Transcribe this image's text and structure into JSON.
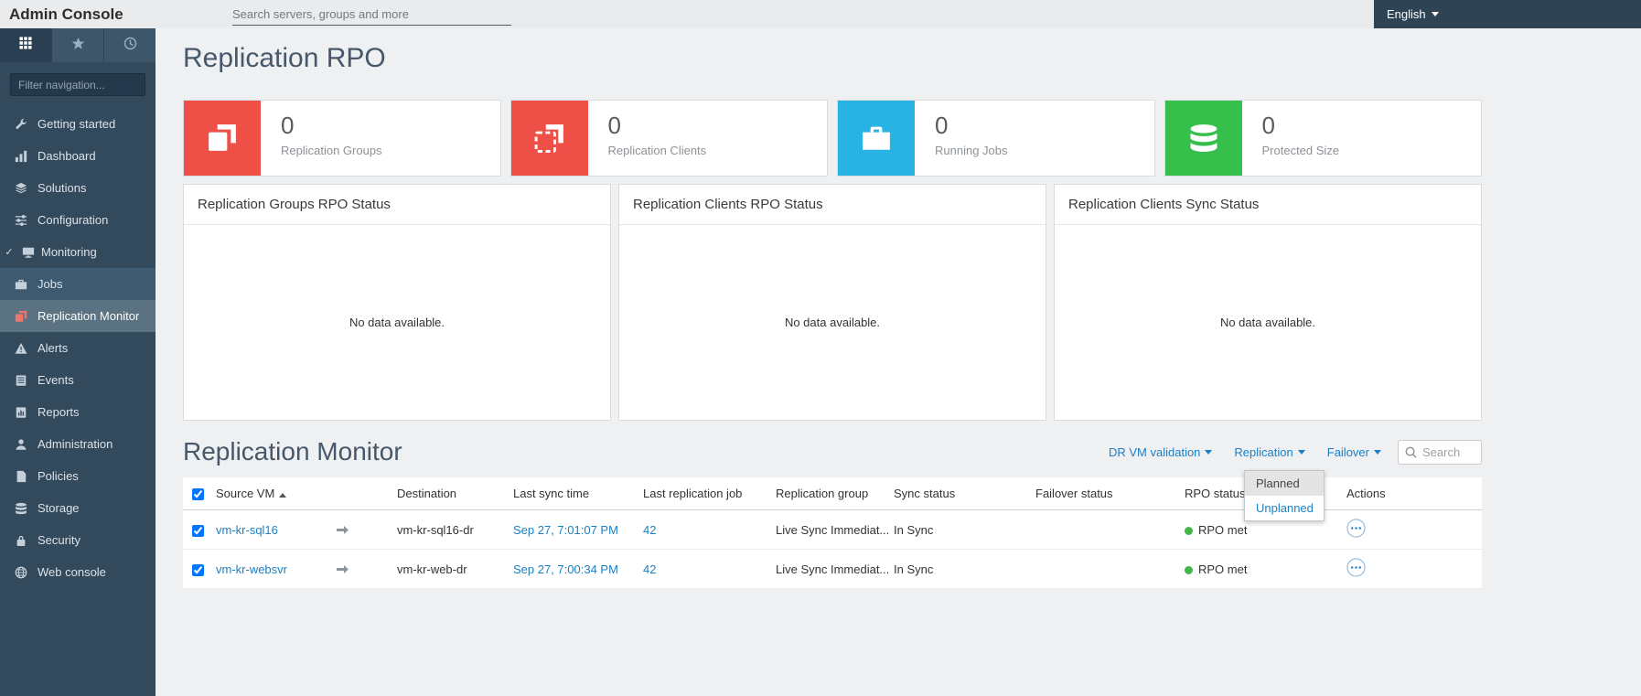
{
  "topbar": {
    "app_title": "Admin Console",
    "search_placeholder": "Search servers, groups and more",
    "language": "English"
  },
  "sidebar": {
    "filter_placeholder": "Filter navigation...",
    "tabs": [
      {
        "name": "navigation",
        "icon": "grid-icon"
      },
      {
        "name": "favorites",
        "icon": "star-icon"
      },
      {
        "name": "recent",
        "icon": "clock-icon"
      }
    ],
    "items": [
      {
        "label": "Getting started",
        "icon": "wrench-icon"
      },
      {
        "label": "Dashboard",
        "icon": "bar-chart-icon"
      },
      {
        "label": "Solutions",
        "icon": "layers-icon"
      },
      {
        "label": "Configuration",
        "icon": "sliders-icon"
      },
      {
        "label": "Monitoring",
        "icon": "monitor-icon",
        "expanded": true
      },
      {
        "label": "Jobs",
        "icon": "briefcase-icon"
      },
      {
        "label": "Replication Monitor",
        "icon": "copy-icon",
        "active": true
      },
      {
        "label": "Alerts",
        "icon": "warning-icon"
      },
      {
        "label": "Events",
        "icon": "list-icon"
      },
      {
        "label": "Reports",
        "icon": "report-icon"
      },
      {
        "label": "Administration",
        "icon": "person-icon"
      },
      {
        "label": "Policies",
        "icon": "document-icon"
      },
      {
        "label": "Storage",
        "icon": "database-icon"
      },
      {
        "label": "Security",
        "icon": "lock-icon"
      },
      {
        "label": "Web console",
        "icon": "globe-icon"
      }
    ]
  },
  "page": {
    "title": "Replication RPO",
    "stat_cards": [
      {
        "value": "0",
        "label": "Replication Groups",
        "color": "#ee4f47",
        "icon": "replication-groups-icon"
      },
      {
        "value": "0",
        "label": "Replication Clients",
        "color": "#ee4f47",
        "icon": "replication-clients-icon"
      },
      {
        "value": "0",
        "label": "Running Jobs",
        "color": "#29b2e4",
        "icon": "briefcase-icon"
      },
      {
        "value": "0",
        "label": "Protected Size",
        "color": "#36c04b",
        "icon": "database-icon"
      }
    ],
    "panels": [
      {
        "title": "Replication Groups RPO Status",
        "empty_text": "No data available."
      },
      {
        "title": "Replication Clients RPO Status",
        "empty_text": "No data available."
      },
      {
        "title": "Replication Clients Sync Status",
        "empty_text": "No data available."
      }
    ]
  },
  "monitor": {
    "title": "Replication Monitor",
    "actions": [
      {
        "label": "DR VM validation"
      },
      {
        "label": "Replication"
      },
      {
        "label": "Failover",
        "open": true
      }
    ],
    "failover_menu": [
      "Planned",
      "Unplanned"
    ],
    "search_placeholder": "Search",
    "table": {
      "select_all": "checked",
      "columns": [
        "Source VM",
        "Destination",
        "Last sync time",
        "Last replication job",
        "Replication group",
        "Sync status",
        "Failover status",
        "RPO status",
        "Actions"
      ],
      "sorted_column": "Source VM",
      "sort_direction": "asc",
      "rows": [
        {
          "selected": "checked",
          "source": "vm-kr-sql16",
          "destination": "vm-kr-sql16-dr",
          "last_sync": "Sep 27, 7:01:07 PM",
          "job": "42",
          "group": "Live Sync Immediat...",
          "sync_status": "In Sync",
          "failover_status": "",
          "rpo_status": "RPO met"
        },
        {
          "selected": "checked",
          "source": "vm-kr-websvr",
          "destination": "vm-kr-web-dr",
          "last_sync": "Sep 27, 7:00:34 PM",
          "job": "42",
          "group": "Live Sync Immediat...",
          "sync_status": "In Sync",
          "failover_status": "",
          "rpo_status": "RPO met"
        }
      ]
    }
  },
  "colors": {
    "sidebar": "#33495c",
    "accent_red": "#ee4f47",
    "accent_blue": "#29b2e4",
    "accent_green": "#36c04b",
    "link_blue": "#1b7fc4",
    "rpo_dot_green": "#42b64a"
  }
}
